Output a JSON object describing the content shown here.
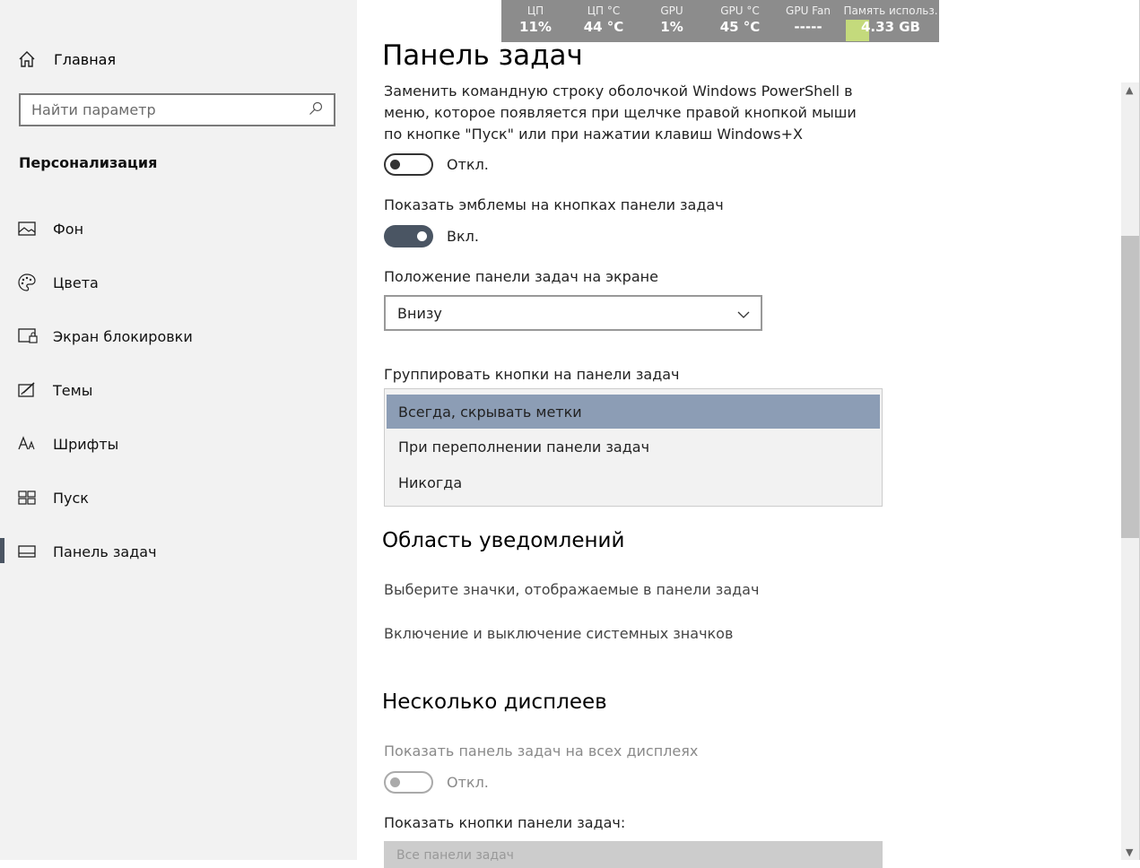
{
  "overlay": {
    "cells": [
      {
        "label": "ЦП",
        "value": "11%"
      },
      {
        "label": "ЦП °C",
        "value": "44 °C"
      },
      {
        "label": "GPU",
        "value": "1%"
      },
      {
        "label": "GPU °C",
        "value": "45 °C"
      },
      {
        "label": "GPU Fan",
        "value": "-----"
      },
      {
        "label": "Память использ.",
        "value": "4.33 GB"
      }
    ]
  },
  "sidebar": {
    "home_label": "Главная",
    "search_placeholder": "Найти параметр",
    "section_title": "Персонализация",
    "items": [
      {
        "label": "Фон",
        "icon": "image-icon"
      },
      {
        "label": "Цвета",
        "icon": "palette-icon"
      },
      {
        "label": "Экран блокировки",
        "icon": "lock-screen-icon"
      },
      {
        "label": "Темы",
        "icon": "themes-icon"
      },
      {
        "label": "Шрифты",
        "icon": "fonts-icon"
      },
      {
        "label": "Пуск",
        "icon": "start-icon"
      },
      {
        "label": "Панель задач",
        "icon": "taskbar-icon"
      }
    ],
    "active_item": "Панель задач"
  },
  "main": {
    "title": "Панель задач",
    "powershell_desc": "Заменить командную строку оболочкой Windows PowerShell в меню, которое появляется при щелчке правой кнопкой мыши по кнопке \"Пуск\" или при нажатии клавиш Windows+X",
    "powershell_state": "Откл.",
    "badges_label": "Показать эмблемы на кнопках панели задач",
    "badges_state": "Вкл.",
    "position_label": "Положение панели задач на экране",
    "position_value": "Внизу",
    "group_label": "Группировать кнопки на панели задач",
    "group_options": [
      "Всегда, скрывать метки",
      "При переполнении панели задач",
      "Никогда"
    ],
    "group_selected": "Всегда, скрывать метки",
    "notif_title": "Область уведомлений",
    "notif_link1": "Выберите значки, отображаемые в панели задач",
    "notif_link2": "Включение и выключение системных значков",
    "multi_title": "Несколько дисплеев",
    "multi_show_label": "Показать панель задач на всех дисплеях",
    "multi_show_state": "Откл.",
    "multi_buttons_label": "Показать кнопки панели задач:",
    "multi_buttons_value": "Все панели задач"
  },
  "colors": {
    "accent": "#4a5563",
    "selected_item": "#8c9db5",
    "overlay_bg": "#8c8c8c",
    "memory_bar": "#c4da7c"
  }
}
